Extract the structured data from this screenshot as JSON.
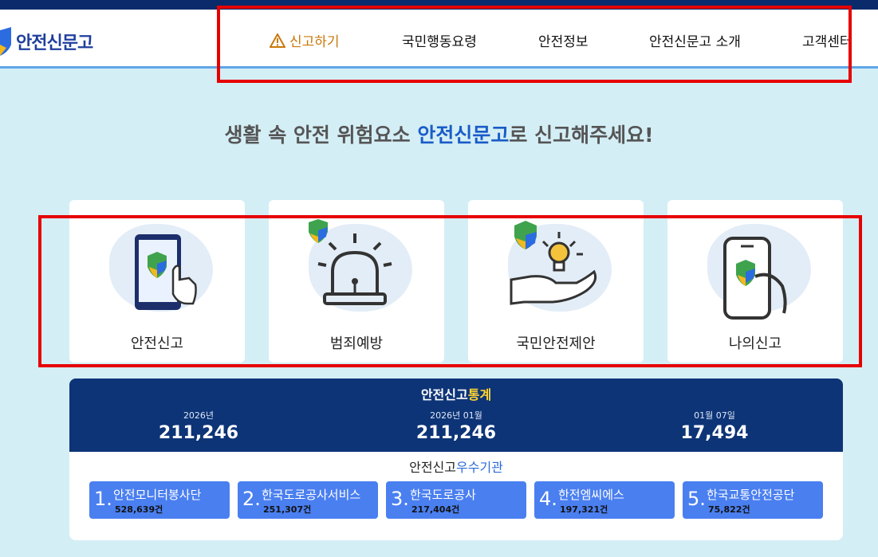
{
  "header": {
    "logo_text": "안전신문고",
    "nav": [
      {
        "label": "신고하기",
        "active": true
      },
      {
        "label": "국민행동요령"
      },
      {
        "label": "안전정보"
      },
      {
        "label": "안전신문고 소개"
      },
      {
        "label": "고객센터"
      }
    ]
  },
  "headline": {
    "prefix": "생활 속 안전 위험요소 ",
    "highlight": "안전신문고",
    "suffix": "로 신고해주세요!"
  },
  "services": [
    {
      "label": "안전신고"
    },
    {
      "label": "범죄예방"
    },
    {
      "label": "국민안전제안"
    },
    {
      "label": "나의신고"
    }
  ],
  "stats": {
    "title_white": "안전신고",
    "title_yellow": "통계",
    "items": [
      {
        "period": "2026년",
        "value": "211,246"
      },
      {
        "period": "2026년 01월",
        "value": "211,246"
      },
      {
        "period": "01월 07일",
        "value": "17,494"
      }
    ]
  },
  "agencies": {
    "title_dark": "안전신고",
    "title_blue": "우수기관",
    "items": [
      {
        "rank": "1.",
        "name": "안전모니터봉사단",
        "count": "528,639건"
      },
      {
        "rank": "2.",
        "name": "한국도로공사서비스",
        "count": "251,307건"
      },
      {
        "rank": "3.",
        "name": "한국도로공사",
        "count": "217,404건"
      },
      {
        "rank": "4.",
        "name": "한전엠씨에스",
        "count": "197,321건"
      },
      {
        "rank": "5.",
        "name": "한국교통안전공단",
        "count": "75,822건"
      }
    ]
  },
  "colors": {
    "accent": "#1a5cc8",
    "active_nav": "#c9780a",
    "stats_bg": "#0d3477",
    "agency_btn": "#4a7ff0",
    "highlight_box": "#e60000"
  }
}
